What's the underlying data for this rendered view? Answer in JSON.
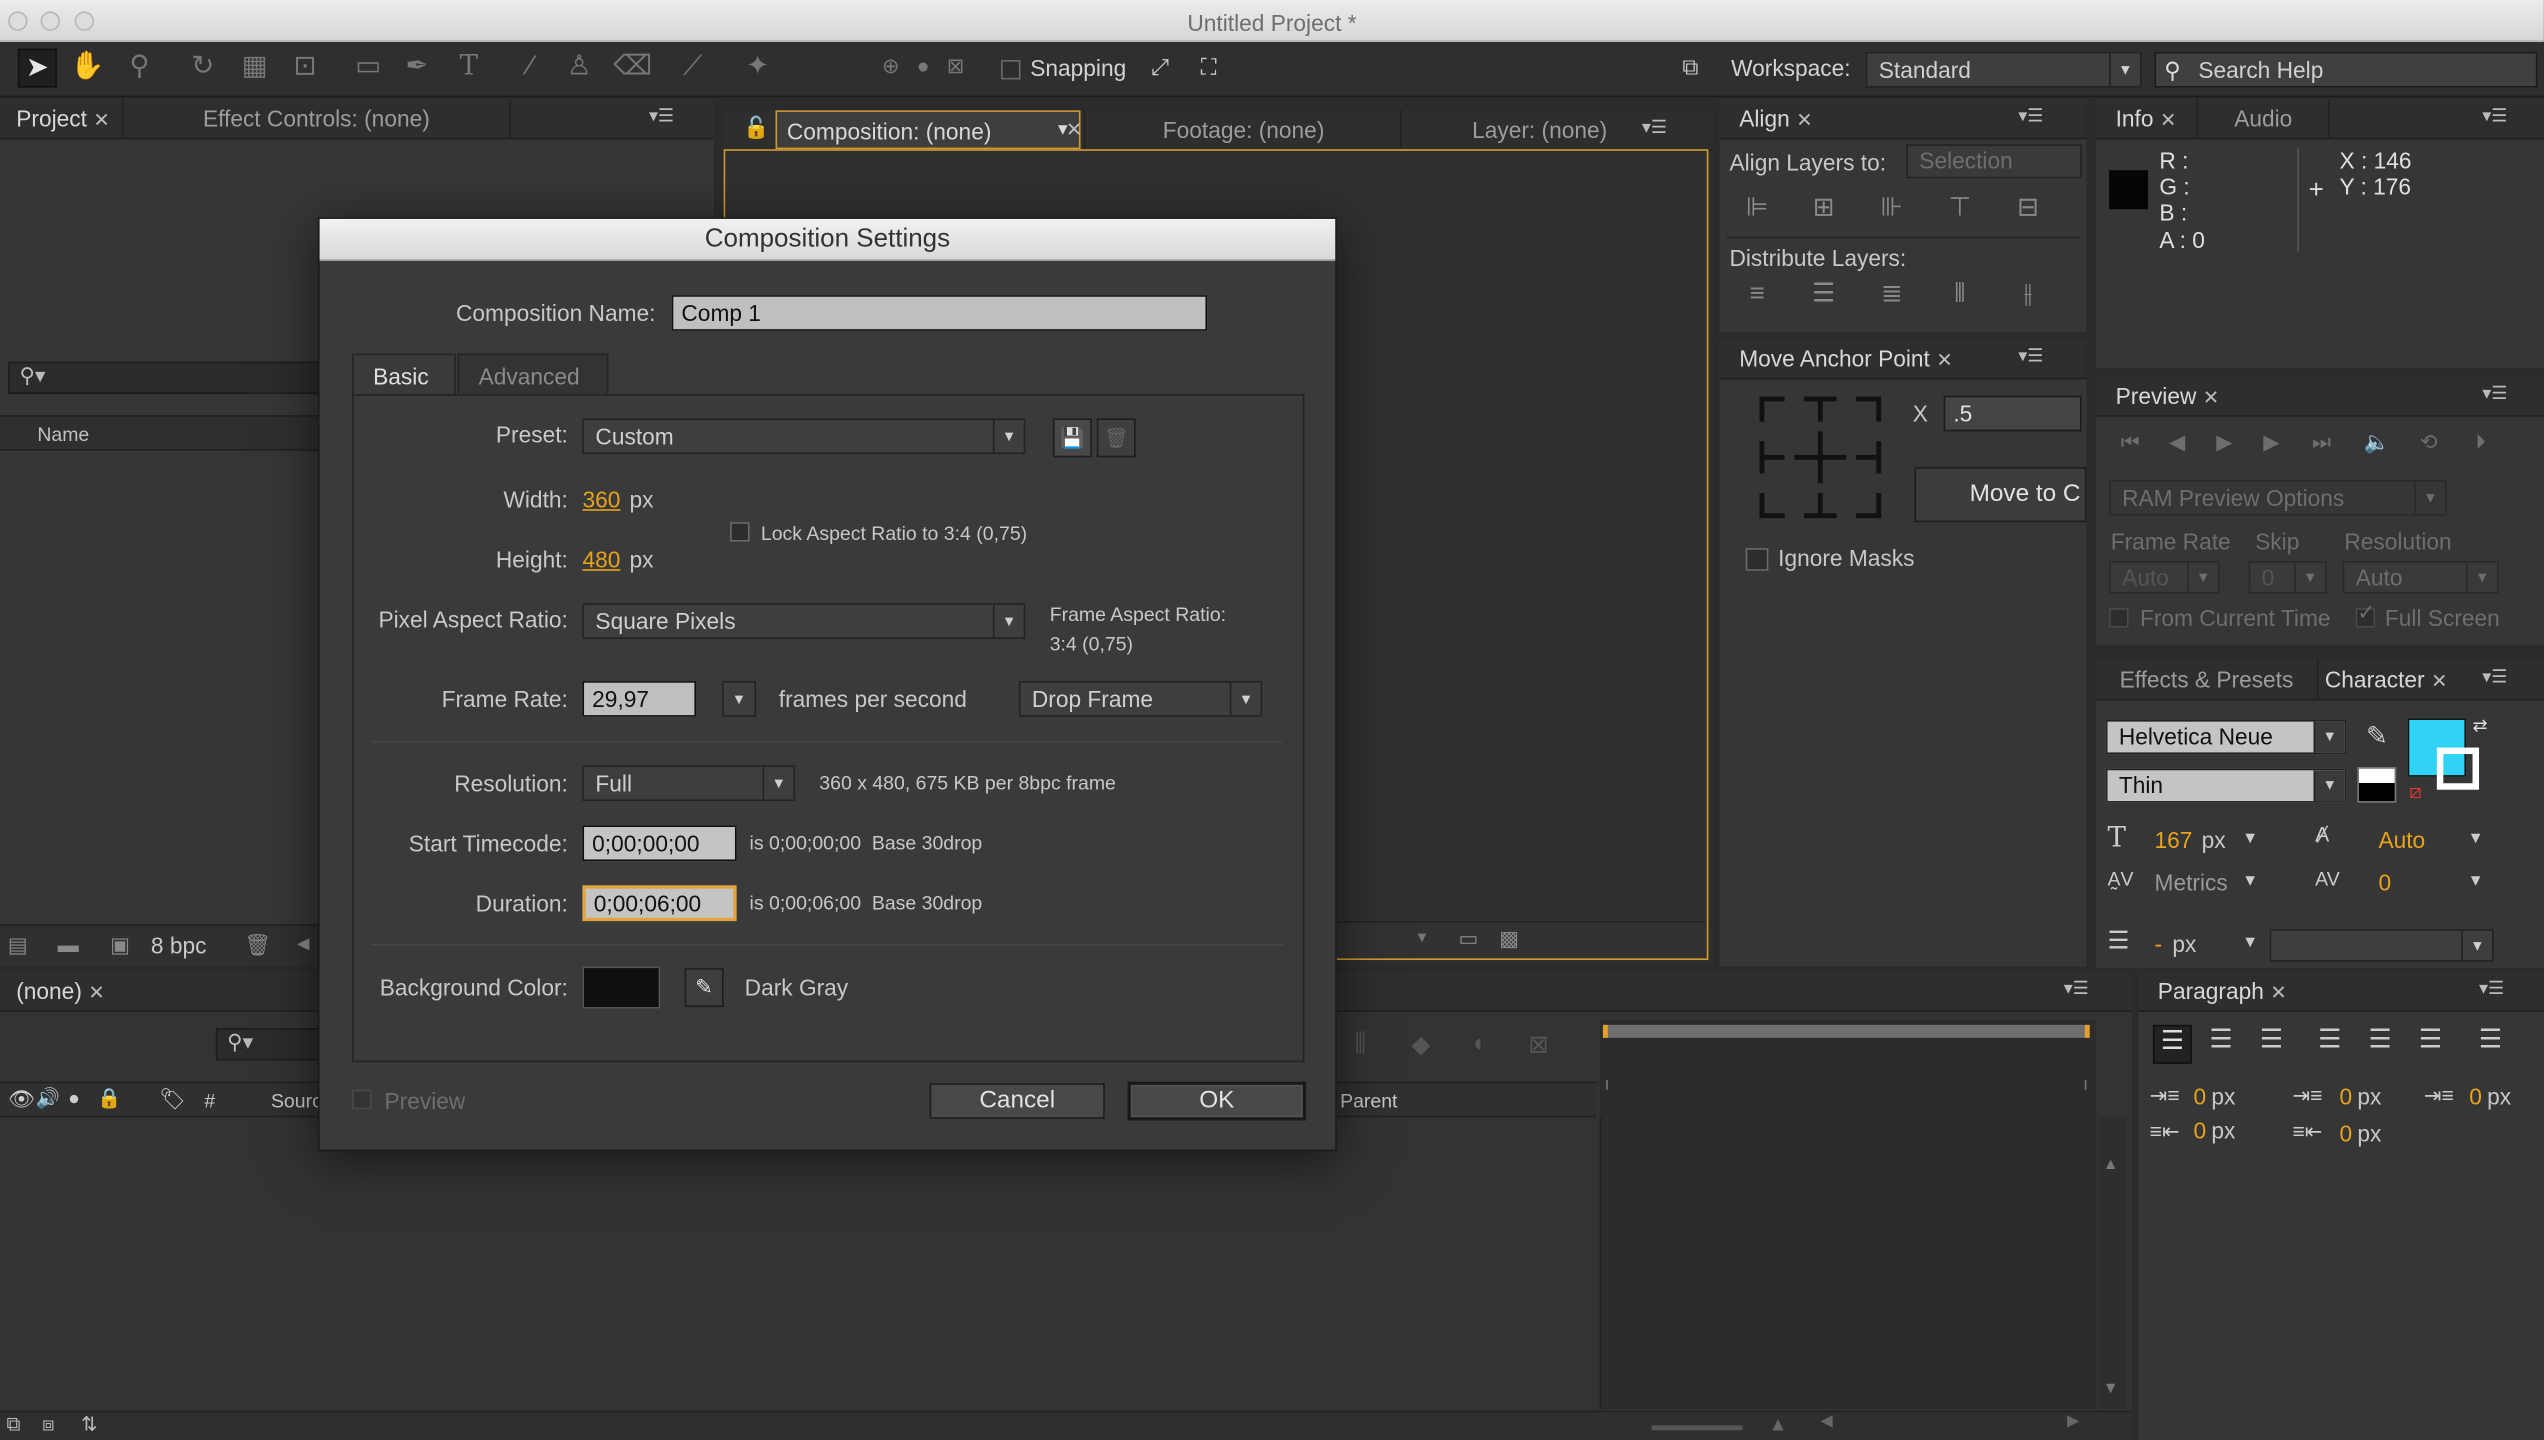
{
  "window": {
    "title": "Untitled Project *"
  },
  "toolbar": {
    "snapping_label": "Snapping",
    "workspace_label": "Workspace:",
    "workspace_value": "Standard",
    "search_placeholder": "Search Help"
  },
  "project_panel": {
    "tab_project": "Project",
    "tab_effect_controls": "Effect Controls: (none)",
    "col_name": "Name",
    "bpc": "8 bpc"
  },
  "comp_viewer": {
    "tab_composition": "Composition: (none)",
    "tab_footage": "Footage: (none)",
    "tab_layer": "Layer: (none)"
  },
  "align_panel": {
    "tab": "Align",
    "align_to_label": "Align Layers to:",
    "align_to_value": "Selection",
    "distribute_label": "Distribute Layers:"
  },
  "move_anchor": {
    "tab": "Move Anchor Point",
    "x_label": "X",
    "x_value": ".5",
    "move_button": "Move to C",
    "ignore_masks": "Ignore Masks"
  },
  "info_panel": {
    "tab_info": "Info",
    "tab_audio": "Audio",
    "r": "R :",
    "g": "G :",
    "b": "B :",
    "a": "A : 0",
    "x": "X : 146",
    "y": "Y : 176"
  },
  "preview_panel": {
    "tab": "Preview",
    "ram_options": "RAM Preview Options",
    "frame_rate_label": "Frame Rate",
    "skip_label": "Skip",
    "resolution_label": "Resolution",
    "frame_rate_value": "Auto",
    "skip_value": "0",
    "resolution_value": "Auto",
    "from_current_time": "From Current Time",
    "full_screen": "Full Screen"
  },
  "character_panel": {
    "tab_effects": "Effects & Presets",
    "tab_character": "Character",
    "font_family": "Helvetica Neue",
    "font_style": "Thin",
    "font_size": "167",
    "font_size_unit": "px",
    "leading": "Auto",
    "kerning": "Metrics",
    "tracking": "0",
    "stroke_width": "-",
    "stroke_unit": "px",
    "fill_color": "#30d2f5"
  },
  "paragraph_panel": {
    "tab": "Paragraph",
    "indent_left": "0",
    "indent_right": "0",
    "indent_first": "0",
    "space_before": "0",
    "space_after": "0",
    "unit": "px"
  },
  "timeline": {
    "tab": "(none)",
    "col_source": "Sourc",
    "col_hash": "#",
    "col_parent": "Parent"
  },
  "dialog": {
    "title": "Composition Settings",
    "name_label": "Composition Name:",
    "name_value": "Comp 1",
    "tab_basic": "Basic",
    "tab_advanced": "Advanced",
    "preset_label": "Preset:",
    "preset_value": "Custom",
    "width_label": "Width:",
    "width_value": "360",
    "height_label": "Height:",
    "height_value": "480",
    "px": "px",
    "lock_aspect": "Lock Aspect Ratio to 3:4 (0,75)",
    "par_label": "Pixel Aspect Ratio:",
    "par_value": "Square Pixels",
    "frame_aspect_label": "Frame Aspect Ratio:",
    "frame_aspect_value": "3:4 (0,75)",
    "frame_rate_label": "Frame Rate:",
    "frame_rate_value": "29,97",
    "fps_label": "frames per second",
    "drop_frame": "Drop Frame",
    "resolution_label": "Resolution:",
    "resolution_value": "Full",
    "resolution_info": "360 x 480, 675 KB per 8bpc frame",
    "start_tc_label": "Start Timecode:",
    "start_tc_value": "0;00;00;00",
    "start_tc_info": "is 0;00;00;00  Base 30drop",
    "duration_label": "Duration:",
    "duration_value": "0;00;06;00",
    "duration_info": "is 0;00;06;00  Base 30drop",
    "bg_label": "Background Color:",
    "bg_name": "Dark Gray",
    "bg_color": "#0f0f0f",
    "preview": "Preview",
    "cancel": "Cancel",
    "ok": "OK"
  }
}
